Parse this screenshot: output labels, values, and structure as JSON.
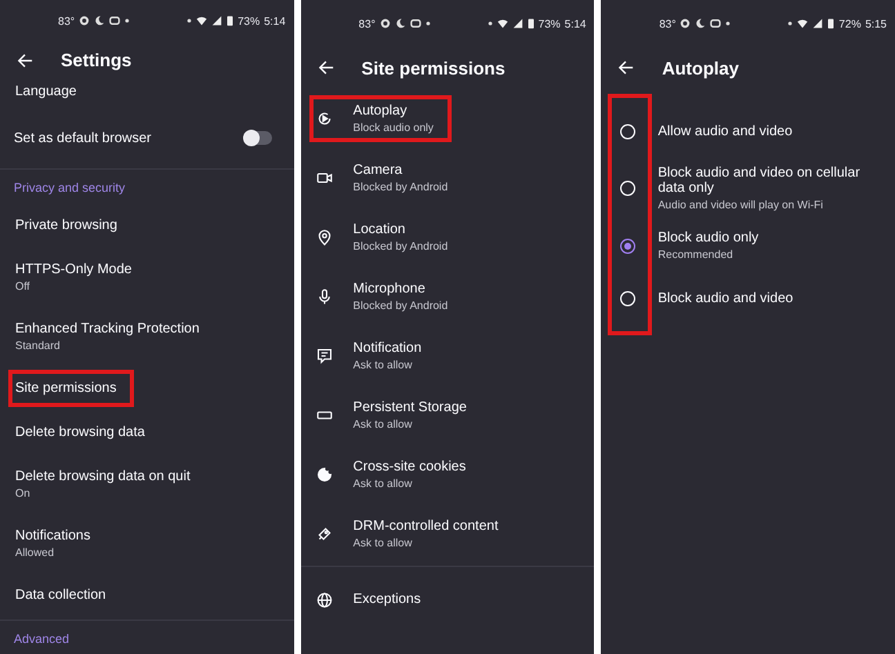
{
  "panels": [
    {
      "status": {
        "temperature": "83°",
        "battery": "73%",
        "time": "5:14"
      },
      "title": "Settings",
      "items": [
        {
          "kind": "row",
          "label": "Language",
          "highlighted": false
        },
        {
          "kind": "toggle",
          "label": "Set as default browser",
          "on": false
        },
        {
          "kind": "divider"
        },
        {
          "kind": "section",
          "label": "Privacy and security"
        },
        {
          "kind": "row",
          "label": "Private browsing",
          "highlighted": false
        },
        {
          "kind": "row",
          "label": "HTTPS-Only Mode",
          "sublabel": "Off",
          "highlighted": false
        },
        {
          "kind": "row",
          "label": "Enhanced Tracking Protection",
          "sublabel": "Standard",
          "highlighted": false
        },
        {
          "kind": "row",
          "label": "Site permissions",
          "highlighted": true
        },
        {
          "kind": "row",
          "label": "Delete browsing data",
          "highlighted": false
        },
        {
          "kind": "row",
          "label": "Delete browsing data on quit",
          "sublabel": "On",
          "highlighted": false
        },
        {
          "kind": "row",
          "label": "Notifications",
          "sublabel": "Allowed",
          "highlighted": false
        },
        {
          "kind": "row",
          "label": "Data collection",
          "highlighted": false
        },
        {
          "kind": "divider"
        },
        {
          "kind": "section",
          "label": "Advanced"
        }
      ]
    },
    {
      "status": {
        "temperature": "83°",
        "battery": "73%",
        "time": "5:14"
      },
      "title": "Site permissions",
      "items": [
        {
          "kind": "icon_row",
          "label": "Autoplay",
          "sublabel": "Block audio only",
          "highlighted": true
        },
        {
          "kind": "icon_row",
          "label": "Camera",
          "sublabel": "Blocked by Android",
          "highlighted": false
        },
        {
          "kind": "icon_row",
          "label": "Location",
          "sublabel": "Blocked by Android",
          "highlighted": false
        },
        {
          "kind": "icon_row",
          "label": "Microphone",
          "sublabel": "Blocked by Android",
          "highlighted": false
        },
        {
          "kind": "icon_row",
          "label": "Notification",
          "sublabel": "Ask to allow",
          "highlighted": false
        },
        {
          "kind": "icon_row",
          "label": "Persistent Storage",
          "sublabel": "Ask to allow",
          "highlighted": false
        },
        {
          "kind": "icon_row",
          "label": "Cross-site cookies",
          "sublabel": "Ask to allow",
          "highlighted": false
        },
        {
          "kind": "icon_row",
          "label": "DRM-controlled content",
          "sublabel": "Ask to allow",
          "highlighted": false
        },
        {
          "kind": "divider"
        },
        {
          "kind": "icon_row",
          "label": "Exceptions",
          "highlighted": false
        }
      ]
    },
    {
      "status": {
        "temperature": "83°",
        "battery": "72%",
        "time": "5:15"
      },
      "title": "Autoplay",
      "radios_highlighted": true,
      "items": [
        {
          "kind": "radio",
          "label": "Allow audio and video",
          "selected": false
        },
        {
          "kind": "radio",
          "label": "Block audio and video on cellular data only",
          "sublabel": "Audio and video will play on Wi-Fi",
          "selected": false
        },
        {
          "kind": "radio",
          "label": "Block audio only",
          "sublabel": "Recommended",
          "selected": true
        },
        {
          "kind": "radio",
          "label": "Block audio and video",
          "selected": false
        }
      ]
    }
  ]
}
